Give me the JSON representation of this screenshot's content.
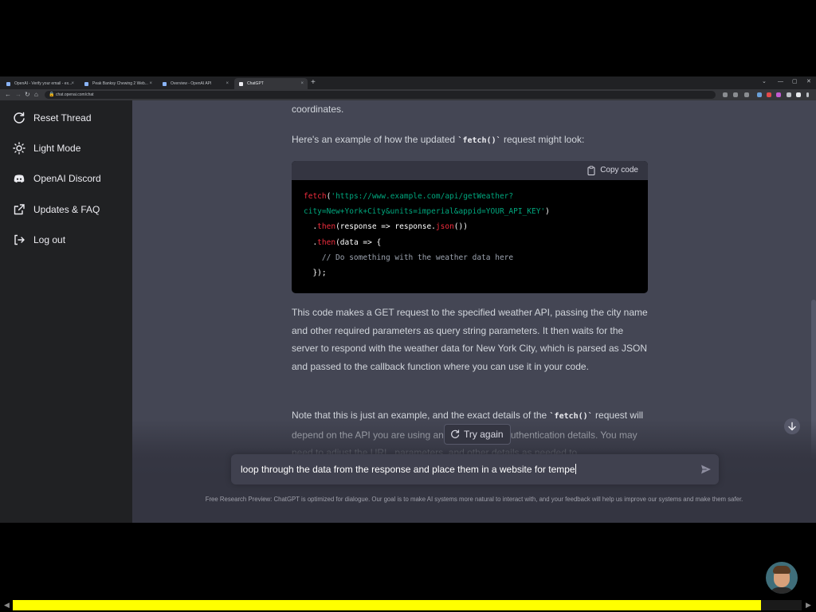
{
  "browser": {
    "tabs": [
      {
        "label": "OpenAI - Verify your email - ex..."
      },
      {
        "label": "Peak Banksy Chewing 2 Web..."
      },
      {
        "label": "Overview - OpenAI API"
      },
      {
        "label": "ChatGPT"
      }
    ],
    "active_tab_index": 3,
    "url": "chat.openai.com/chat",
    "new_tab_icon": "plus-icon"
  },
  "sidebar": {
    "items": [
      {
        "label": "Reset Thread",
        "icon": "refresh-icon"
      },
      {
        "label": "Light Mode",
        "icon": "sun-icon"
      },
      {
        "label": "OpenAI Discord",
        "icon": "discord-icon"
      },
      {
        "label": "Updates & FAQ",
        "icon": "external-link-icon"
      },
      {
        "label": "Log out",
        "icon": "logout-icon"
      }
    ]
  },
  "conversation": {
    "para_top": "coordinates.",
    "intro_before": "Here's an example of how the updated ",
    "intro_code": "`fetch()`",
    "intro_after": " request might look:",
    "code_block": {
      "copy_label": "Copy code",
      "lines": [
        [
          {
            "t": "fetch",
            "c": "fn"
          },
          {
            "t": "(",
            "c": ""
          },
          {
            "t": "'https://www.example.com/api/getWeather?",
            "c": "str"
          }
        ],
        [
          {
            "t": "city=New+York+City&units=imperial&appid=YOUR_API_KEY'",
            "c": "str"
          },
          {
            "t": ")",
            "c": ""
          }
        ],
        [
          {
            "t": "  .",
            "c": ""
          },
          {
            "t": "then",
            "c": "fn"
          },
          {
            "t": "(response => response.",
            "c": ""
          },
          {
            "t": "json",
            "c": "fn"
          },
          {
            "t": "())",
            "c": ""
          }
        ],
        [
          {
            "t": "  .",
            "c": ""
          },
          {
            "t": "then",
            "c": "fn"
          },
          {
            "t": "(data => {",
            "c": ""
          }
        ],
        [
          {
            "t": "    // Do something with the weather data here",
            "c": "cm"
          }
        ],
        [
          {
            "t": "  });",
            "c": ""
          }
        ]
      ]
    },
    "para_explain": "This code makes a GET request to the specified weather API, passing the city name and other required parameters as query string parameters. It then waits for the server to respond with the weather data for New York City, which is parsed as JSON and passed to the callback function where you can use it in your code.",
    "note_before": "Note that this is just an example, and the exact details of the ",
    "note_code": "`fetch()`",
    "note_after": " request will depend on the API you are using and the required authentication details. You may need to adjust the URL, parameters, and other details as needed to",
    "try_again_label": "Try again"
  },
  "composer": {
    "value": "loop through the data from the response and place them in a website for tempe",
    "send_icon": "send-icon"
  },
  "disclaimer": "Free Research Preview: ChatGPT is optimized for dialogue. Our goal is to make AI systems more natural to interact with, and your feedback will help us improve our systems and make them safer.",
  "video_player": {
    "progress_fraction": 0.948,
    "progress_color": "#ffff00"
  },
  "colors": {
    "sidebar_bg": "#202123",
    "main_bg": "#444654",
    "code_fn": "#f22c3d",
    "code_string": "#00a67d"
  }
}
